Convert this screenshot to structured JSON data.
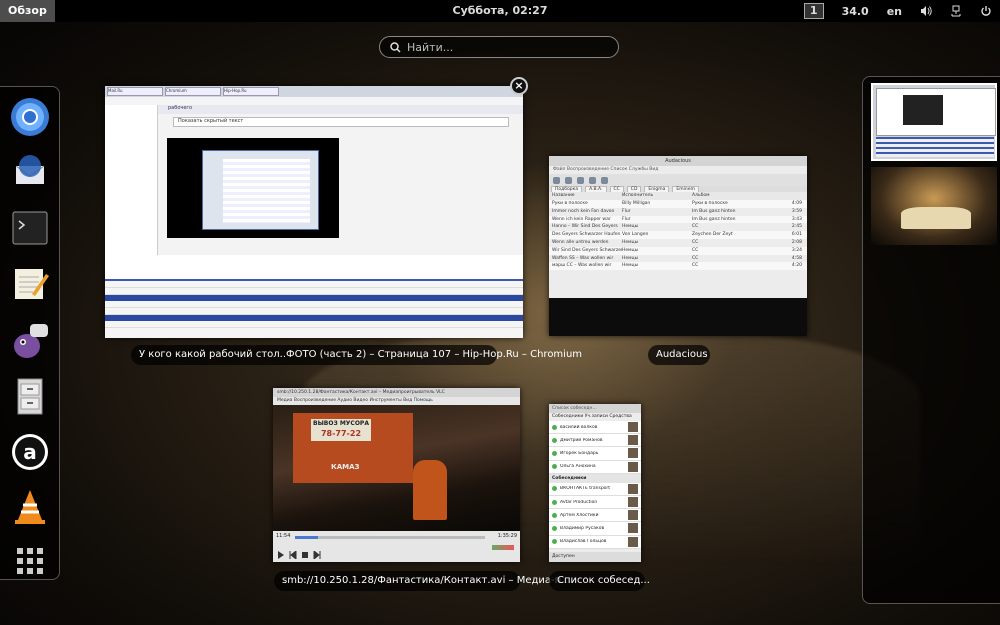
{
  "top_bar": {
    "activities_label": "Обзор",
    "clock": "Суббота, 02:27",
    "workspace_number": "1",
    "temperature": "34.0",
    "keyboard_layout": "en"
  },
  "search": {
    "placeholder": "Найти..."
  },
  "dash": {
    "items": [
      {
        "name": "chromium"
      },
      {
        "name": "thunderbird"
      },
      {
        "name": "terminal"
      },
      {
        "name": "text-editor"
      },
      {
        "name": "pidgin"
      },
      {
        "name": "file-cabinet"
      },
      {
        "name": "amazon"
      },
      {
        "name": "vlc"
      },
      {
        "name": "show-applications"
      }
    ]
  },
  "windows": {
    "chromium": {
      "label": "У кого какой рабочий стол..ФОТО (часть 2) – Страница 107 – Hip-Hop.Ru – Chromium",
      "tabs": [
        "Mail.Ru",
        "Chromium",
        "Hip-Hop.Ru"
      ],
      "spoiler_text": "Показать скрытый текст",
      "post_title": "рабочего"
    },
    "audacious": {
      "label": "Audacious",
      "title": "Audacious",
      "menu": "Файл   Воспроизведение   Список   Службы   Вид",
      "tabs": [
        "Подборка",
        "A.B.A.",
        "CC",
        "CD",
        "Enigma",
        "Eminem"
      ],
      "columns": [
        "Название",
        "Исполнитель",
        "Альбом",
        ""
      ],
      "rows": [
        [
          "Руки в полоске",
          "Billy Milligan",
          "Руки в полоске",
          "4:09"
        ],
        [
          "Immer noch kein Fan davon",
          "Flur",
          "Im Bus ganz hinten",
          "3:59"
        ],
        [
          "Wenn ich kein Rapper war",
          "Flur",
          "Im Bus ganz hinten",
          "3:43"
        ],
        [
          "Hanno – Wir Sind Des Geyers",
          "Немцы",
          "CC",
          "2:45"
        ],
        [
          "Des Geyers Schwarzer Haufen",
          "Von Langen",
          "Zeychen Der Zeyt",
          "6:01"
        ],
        [
          "Wenn alle untreu werden",
          "Немцы",
          "CC",
          "2:08"
        ],
        [
          "Wir Sind Des Geyers Schwarzer",
          "Немцы",
          "CC",
          "3:24"
        ],
        [
          "Waffen SS – Was wollen wir",
          "Немцы",
          "CC",
          "4:58"
        ],
        [
          "марш CC – Was wollen wir",
          "Немцы",
          "CC",
          "4:20"
        ]
      ]
    },
    "vlc": {
      "label": "smb://10.250.1.28/Фантастика/Контакт.avi – Медиа-п...",
      "title": "smb://10.250.1.28/Фантастика/Контакт.avi – Медиапроигрыватель VLC",
      "menu": "Медиа   Воспроизведение   Аудио   Видео   Инструменты   Вид   Помощь",
      "sign_text_1": "ВЫВОЗ МУСОРА",
      "sign_text_2": "78-77-22",
      "truck_brand": "КАМАЗ",
      "time_elapsed": "11:54",
      "time_total": "1:35:29",
      "progress": 0.12
    },
    "contact_list": {
      "label": "Список собесед...",
      "title": "Список собеседн...",
      "menu": "Собеседники   Уч.записи   Средства",
      "contacts_top": [
        "василий волков",
        "Дмитрий Романов",
        "Игорек Бондарь",
        "Ольга Анохина"
      ],
      "group_name": "Собеседники",
      "contacts_group": [
        "ВКОНТАКТЕ transport",
        "Avtar Production",
        "Артем Хлостикй",
        "Владимир Русаков",
        "Владислав Гольцов"
      ],
      "status": "Доступен"
    }
  },
  "workspaces": {
    "count": 2,
    "active": 1
  }
}
